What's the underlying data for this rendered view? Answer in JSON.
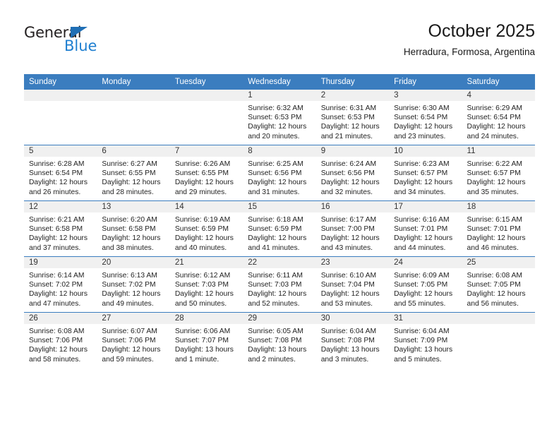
{
  "logo": {
    "word_primary": "General",
    "word_secondary": "Blue",
    "triangle_color": "#1f6fb5",
    "secondary_color": "#1f7fd0"
  },
  "header": {
    "title": "October 2025",
    "subtitle": "Herradura, Formosa, Argentina"
  },
  "theme": {
    "header_bar": "#3b7dbf",
    "daynum_band": "#f0f0f0",
    "row_divider": "#3b7dbf",
    "text": "#222222"
  },
  "weekdays": [
    "Sunday",
    "Monday",
    "Tuesday",
    "Wednesday",
    "Thursday",
    "Friday",
    "Saturday"
  ],
  "weeks": [
    [
      {
        "day": "",
        "sunrise": "",
        "sunset": "",
        "daylight_1": "",
        "daylight_2": ""
      },
      {
        "day": "",
        "sunrise": "",
        "sunset": "",
        "daylight_1": "",
        "daylight_2": ""
      },
      {
        "day": "",
        "sunrise": "",
        "sunset": "",
        "daylight_1": "",
        "daylight_2": ""
      },
      {
        "day": "1",
        "sunrise": "Sunrise: 6:32 AM",
        "sunset": "Sunset: 6:53 PM",
        "daylight_1": "Daylight: 12 hours",
        "daylight_2": "and 20 minutes."
      },
      {
        "day": "2",
        "sunrise": "Sunrise: 6:31 AM",
        "sunset": "Sunset: 6:53 PM",
        "daylight_1": "Daylight: 12 hours",
        "daylight_2": "and 21 minutes."
      },
      {
        "day": "3",
        "sunrise": "Sunrise: 6:30 AM",
        "sunset": "Sunset: 6:54 PM",
        "daylight_1": "Daylight: 12 hours",
        "daylight_2": "and 23 minutes."
      },
      {
        "day": "4",
        "sunrise": "Sunrise: 6:29 AM",
        "sunset": "Sunset: 6:54 PM",
        "daylight_1": "Daylight: 12 hours",
        "daylight_2": "and 24 minutes."
      }
    ],
    [
      {
        "day": "5",
        "sunrise": "Sunrise: 6:28 AM",
        "sunset": "Sunset: 6:54 PM",
        "daylight_1": "Daylight: 12 hours",
        "daylight_2": "and 26 minutes."
      },
      {
        "day": "6",
        "sunrise": "Sunrise: 6:27 AM",
        "sunset": "Sunset: 6:55 PM",
        "daylight_1": "Daylight: 12 hours",
        "daylight_2": "and 28 minutes."
      },
      {
        "day": "7",
        "sunrise": "Sunrise: 6:26 AM",
        "sunset": "Sunset: 6:55 PM",
        "daylight_1": "Daylight: 12 hours",
        "daylight_2": "and 29 minutes."
      },
      {
        "day": "8",
        "sunrise": "Sunrise: 6:25 AM",
        "sunset": "Sunset: 6:56 PM",
        "daylight_1": "Daylight: 12 hours",
        "daylight_2": "and 31 minutes."
      },
      {
        "day": "9",
        "sunrise": "Sunrise: 6:24 AM",
        "sunset": "Sunset: 6:56 PM",
        "daylight_1": "Daylight: 12 hours",
        "daylight_2": "and 32 minutes."
      },
      {
        "day": "10",
        "sunrise": "Sunrise: 6:23 AM",
        "sunset": "Sunset: 6:57 PM",
        "daylight_1": "Daylight: 12 hours",
        "daylight_2": "and 34 minutes."
      },
      {
        "day": "11",
        "sunrise": "Sunrise: 6:22 AM",
        "sunset": "Sunset: 6:57 PM",
        "daylight_1": "Daylight: 12 hours",
        "daylight_2": "and 35 minutes."
      }
    ],
    [
      {
        "day": "12",
        "sunrise": "Sunrise: 6:21 AM",
        "sunset": "Sunset: 6:58 PM",
        "daylight_1": "Daylight: 12 hours",
        "daylight_2": "and 37 minutes."
      },
      {
        "day": "13",
        "sunrise": "Sunrise: 6:20 AM",
        "sunset": "Sunset: 6:58 PM",
        "daylight_1": "Daylight: 12 hours",
        "daylight_2": "and 38 minutes."
      },
      {
        "day": "14",
        "sunrise": "Sunrise: 6:19 AM",
        "sunset": "Sunset: 6:59 PM",
        "daylight_1": "Daylight: 12 hours",
        "daylight_2": "and 40 minutes."
      },
      {
        "day": "15",
        "sunrise": "Sunrise: 6:18 AM",
        "sunset": "Sunset: 6:59 PM",
        "daylight_1": "Daylight: 12 hours",
        "daylight_2": "and 41 minutes."
      },
      {
        "day": "16",
        "sunrise": "Sunrise: 6:17 AM",
        "sunset": "Sunset: 7:00 PM",
        "daylight_1": "Daylight: 12 hours",
        "daylight_2": "and 43 minutes."
      },
      {
        "day": "17",
        "sunrise": "Sunrise: 6:16 AM",
        "sunset": "Sunset: 7:01 PM",
        "daylight_1": "Daylight: 12 hours",
        "daylight_2": "and 44 minutes."
      },
      {
        "day": "18",
        "sunrise": "Sunrise: 6:15 AM",
        "sunset": "Sunset: 7:01 PM",
        "daylight_1": "Daylight: 12 hours",
        "daylight_2": "and 46 minutes."
      }
    ],
    [
      {
        "day": "19",
        "sunrise": "Sunrise: 6:14 AM",
        "sunset": "Sunset: 7:02 PM",
        "daylight_1": "Daylight: 12 hours",
        "daylight_2": "and 47 minutes."
      },
      {
        "day": "20",
        "sunrise": "Sunrise: 6:13 AM",
        "sunset": "Sunset: 7:02 PM",
        "daylight_1": "Daylight: 12 hours",
        "daylight_2": "and 49 minutes."
      },
      {
        "day": "21",
        "sunrise": "Sunrise: 6:12 AM",
        "sunset": "Sunset: 7:03 PM",
        "daylight_1": "Daylight: 12 hours",
        "daylight_2": "and 50 minutes."
      },
      {
        "day": "22",
        "sunrise": "Sunrise: 6:11 AM",
        "sunset": "Sunset: 7:03 PM",
        "daylight_1": "Daylight: 12 hours",
        "daylight_2": "and 52 minutes."
      },
      {
        "day": "23",
        "sunrise": "Sunrise: 6:10 AM",
        "sunset": "Sunset: 7:04 PM",
        "daylight_1": "Daylight: 12 hours",
        "daylight_2": "and 53 minutes."
      },
      {
        "day": "24",
        "sunrise": "Sunrise: 6:09 AM",
        "sunset": "Sunset: 7:05 PM",
        "daylight_1": "Daylight: 12 hours",
        "daylight_2": "and 55 minutes."
      },
      {
        "day": "25",
        "sunrise": "Sunrise: 6:08 AM",
        "sunset": "Sunset: 7:05 PM",
        "daylight_1": "Daylight: 12 hours",
        "daylight_2": "and 56 minutes."
      }
    ],
    [
      {
        "day": "26",
        "sunrise": "Sunrise: 6:08 AM",
        "sunset": "Sunset: 7:06 PM",
        "daylight_1": "Daylight: 12 hours",
        "daylight_2": "and 58 minutes."
      },
      {
        "day": "27",
        "sunrise": "Sunrise: 6:07 AM",
        "sunset": "Sunset: 7:06 PM",
        "daylight_1": "Daylight: 12 hours",
        "daylight_2": "and 59 minutes."
      },
      {
        "day": "28",
        "sunrise": "Sunrise: 6:06 AM",
        "sunset": "Sunset: 7:07 PM",
        "daylight_1": "Daylight: 13 hours",
        "daylight_2": "and 1 minute."
      },
      {
        "day": "29",
        "sunrise": "Sunrise: 6:05 AM",
        "sunset": "Sunset: 7:08 PM",
        "daylight_1": "Daylight: 13 hours",
        "daylight_2": "and 2 minutes."
      },
      {
        "day": "30",
        "sunrise": "Sunrise: 6:04 AM",
        "sunset": "Sunset: 7:08 PM",
        "daylight_1": "Daylight: 13 hours",
        "daylight_2": "and 3 minutes."
      },
      {
        "day": "31",
        "sunrise": "Sunrise: 6:04 AM",
        "sunset": "Sunset: 7:09 PM",
        "daylight_1": "Daylight: 13 hours",
        "daylight_2": "and 5 minutes."
      },
      {
        "day": "",
        "sunrise": "",
        "sunset": "",
        "daylight_1": "",
        "daylight_2": ""
      }
    ]
  ]
}
